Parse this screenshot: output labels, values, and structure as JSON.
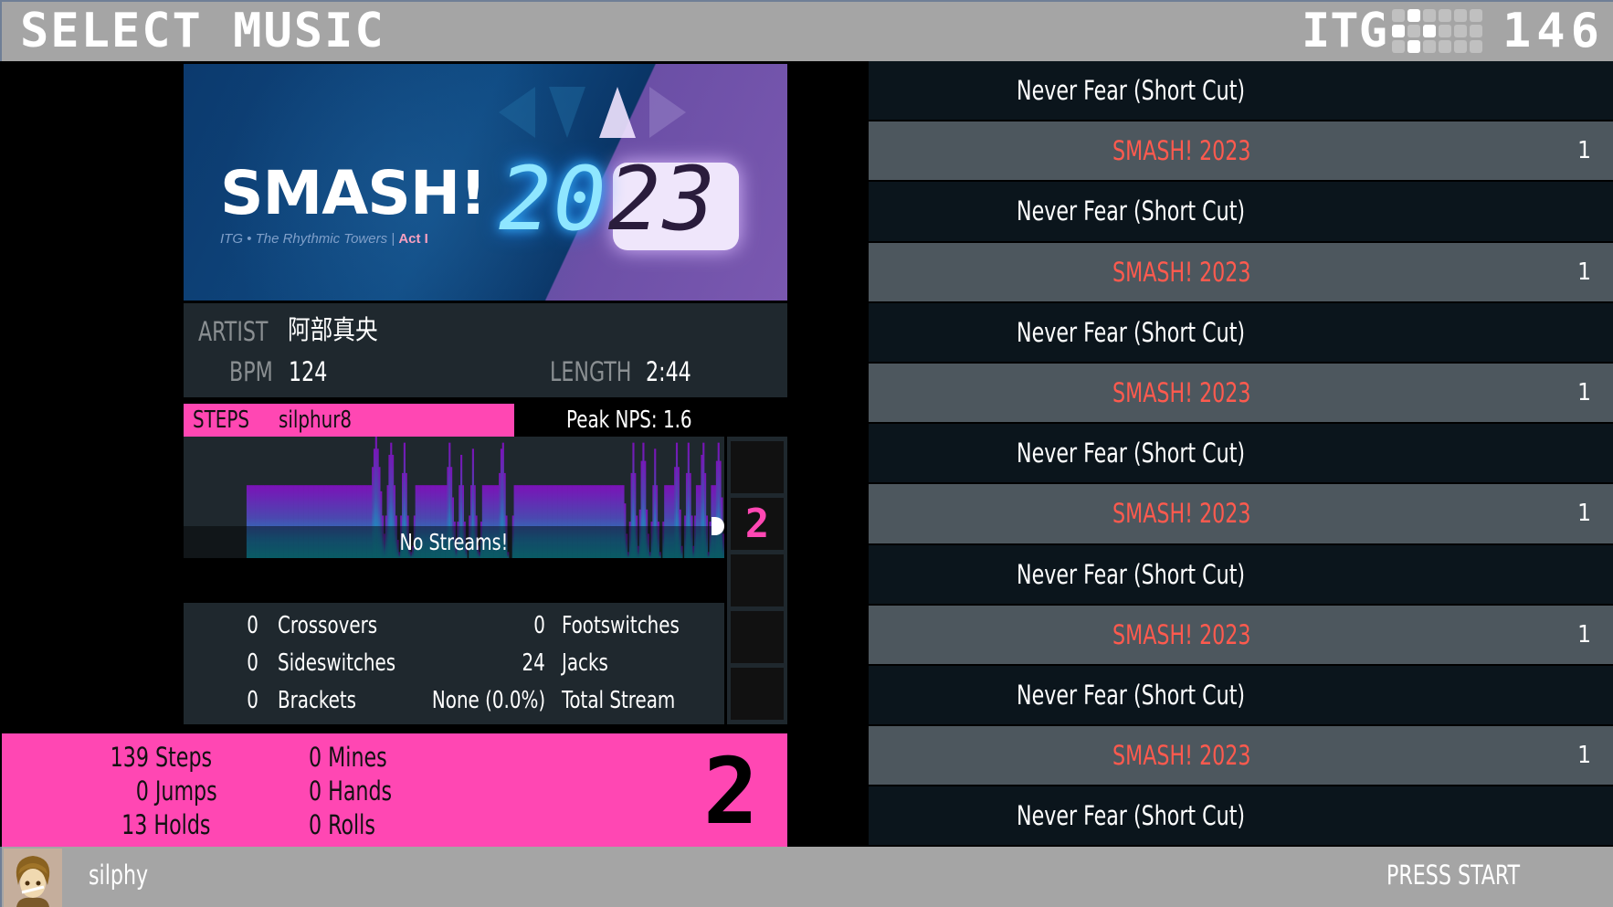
{
  "header": {
    "title": "SELECT MUSIC",
    "mode": "ITG",
    "stage_counter": "146",
    "stage_grid": [
      [
        0,
        1,
        0,
        0,
        0,
        0
      ],
      [
        1,
        0,
        1,
        0,
        0,
        0
      ],
      [
        0,
        1,
        0,
        0,
        0,
        0
      ]
    ]
  },
  "banner": {
    "logo": "SMASH!",
    "subtitle_left": "ITG  •  The Rhythmic Towers  |  ",
    "subtitle_act": "Act I",
    "year_part1": "20",
    "year_part2": "23"
  },
  "song_info": {
    "artist_label": "ARTIST",
    "artist": "阿部真央",
    "bpm_label": "BPM",
    "bpm": "124",
    "length_label": "LENGTH",
    "length": "2:44"
  },
  "steps": {
    "label": "STEPS",
    "author": "silphur8",
    "peak_nps": "Peak NPS: 1.6"
  },
  "density": {
    "stream_text": "No Streams!",
    "bars": [
      0,
      0,
      0,
      0,
      0,
      0,
      0,
      0,
      0,
      0,
      0,
      0,
      0,
      0,
      0,
      0,
      0,
      0,
      0.6,
      0.6,
      0.6,
      0.6,
      0.6,
      0.6,
      0.6,
      0.6,
      0.6,
      0.6,
      0.6,
      0.6,
      0.6,
      0.6,
      0.6,
      0.6,
      0.6,
      0.6,
      0.6,
      0.6,
      0.6,
      0.6,
      0.6,
      0.6,
      0.6,
      0.6,
      0.6,
      0.6,
      0.6,
      0.6,
      0.6,
      0.6,
      0.6,
      0.6,
      0.6,
      0.6,
      0.6,
      0.6,
      0.6,
      0.6,
      0.6,
      0.6,
      0.6,
      0.6,
      0.6,
      0.6,
      0.6,
      0.6,
      0.6,
      0.6,
      0.6,
      0.6,
      0.6,
      0.6,
      0.6,
      0.6,
      0.6,
      0.6,
      0.6,
      0.6,
      0.6,
      0.6,
      0.6,
      0.6,
      0.6,
      0.6,
      0.6,
      0.6,
      0.6,
      0.6,
      0.6,
      0.6,
      0.6,
      0.6,
      0.6,
      0.75,
      0.9,
      1.0,
      0.9,
      0.75,
      0.55,
      0.35,
      0.2,
      0.35,
      0.6,
      0.85,
      0.95,
      0.85,
      0.6,
      0.35,
      0.15,
      0.05,
      0.35,
      0.7,
      0.95,
      0.7,
      0.35,
      0.1,
      0.05,
      0.1,
      0.35,
      0.6,
      0.6,
      0.6,
      0.6,
      0.6,
      0.6,
      0.6,
      0.6,
      0.6,
      0.6,
      0.6,
      0.6,
      0.6,
      0.6,
      0.6,
      0.6,
      0.6,
      0.6,
      0.6,
      0.75,
      0.95,
      0.75,
      0.5,
      0.3,
      0.1,
      0.3,
      0.6,
      0.85,
      0.6,
      0.3,
      0.1,
      0.0,
      0.35,
      0.6,
      0.9,
      0.6,
      0.35,
      0.1,
      0.05,
      0.3,
      0.6,
      0.6,
      0.6,
      0.6,
      0.6,
      0.6,
      0.6,
      0.6,
      0.6,
      0.6,
      0.7,
      0.9,
      0.95,
      0.7,
      0.35,
      0.05,
      0.0,
      0.0,
      0.35,
      0.6,
      0.6,
      0.6,
      0.6,
      0.6,
      0.6,
      0.6,
      0.6,
      0.6,
      0.6,
      0.6,
      0.6,
      0.6,
      0.6,
      0.6,
      0.6,
      0.6,
      0.6,
      0.6,
      0.6,
      0.6,
      0.6,
      0.6,
      0.6,
      0.6,
      0.6,
      0.6,
      0.6,
      0.6,
      0.6,
      0.6,
      0.6,
      0.6,
      0.6,
      0.6,
      0.6,
      0.6,
      0.6,
      0.6,
      0.6,
      0.6,
      0.6,
      0.6,
      0.6,
      0.6,
      0.6,
      0.6,
      0.6,
      0.6,
      0.6,
      0.6,
      0.6,
      0.6,
      0.6,
      0.6,
      0.6,
      0.6,
      0.6,
      0.6,
      0.6,
      0.6,
      0.6,
      0.6,
      0.6,
      0.6,
      0.6,
      0.45,
      0.2,
      0.05,
      0.3,
      0.7,
      0.95,
      0.7,
      0.35,
      0.1,
      0.4,
      0.8,
      0.95,
      0.8,
      0.4,
      0.2,
      0.05,
      0.3,
      0.6,
      0.9,
      0.6,
      0.3,
      0.05,
      0.0,
      0.3,
      0.6,
      0.6,
      0.6,
      0.6,
      0.6,
      0.6,
      0.75,
      0.95,
      0.75,
      0.4,
      0.1,
      0.0,
      0.35,
      0.7,
      0.95,
      0.7,
      0.35,
      0.1,
      0.35,
      0.6,
      0.6,
      0.6,
      0.85,
      0.95,
      0.7,
      0.35,
      0.05,
      0.3,
      0.6,
      0.6,
      0.6,
      0.8,
      0.95,
      0.8,
      0.5,
      0.2
    ]
  },
  "tech": {
    "left": [
      {
        "value": "0",
        "label": "Crossovers"
      },
      {
        "value": "0",
        "label": "Sideswitches"
      },
      {
        "value": "0",
        "label": "Brackets"
      }
    ],
    "right": [
      {
        "value": "0",
        "label": "Footswitches"
      },
      {
        "value": "24",
        "label": "Jacks"
      },
      {
        "value": "None (0.0%)",
        "label": "Total Stream"
      }
    ]
  },
  "meter": {
    "cells": [
      "",
      "2",
      "",
      "",
      ""
    ],
    "selected_index": 1,
    "big_value": "2"
  },
  "stats": {
    "left": [
      "139 Steps",
      "0 Jumps",
      "13 Holds"
    ],
    "right": [
      "0 Mines",
      "0 Hands",
      "0 Rolls"
    ]
  },
  "song_list": [
    {
      "type": "song",
      "title": "Never Fear (Short Cut)",
      "count": ""
    },
    {
      "type": "group",
      "title": "SMASH! 2023",
      "count": "1"
    },
    {
      "type": "song",
      "title": "Never Fear (Short Cut)",
      "count": ""
    },
    {
      "type": "group",
      "title": "SMASH! 2023",
      "count": "1"
    },
    {
      "type": "song",
      "title": "Never Fear (Short Cut)",
      "count": ""
    },
    {
      "type": "group",
      "title": "SMASH! 2023",
      "count": "1"
    },
    {
      "type": "song",
      "title": "Never Fear (Short Cut)",
      "count": ""
    },
    {
      "type": "group",
      "title": "SMASH! 2023",
      "count": "1"
    },
    {
      "type": "song",
      "title": "Never Fear (Short Cut)",
      "count": ""
    },
    {
      "type": "group",
      "title": "SMASH! 2023",
      "count": "1"
    },
    {
      "type": "song",
      "title": "Never Fear (Short Cut)",
      "count": ""
    },
    {
      "type": "group",
      "title": "SMASH! 2023",
      "count": "1"
    },
    {
      "type": "song",
      "title": "Never Fear (Short Cut)",
      "count": ""
    }
  ],
  "footer": {
    "player_name": "silphy",
    "press_start": "PRESS START"
  },
  "colors": {
    "accent_pink": "#ff47b3",
    "group_title": "#ff5a4e",
    "header_gray": "#a5a5a5"
  }
}
